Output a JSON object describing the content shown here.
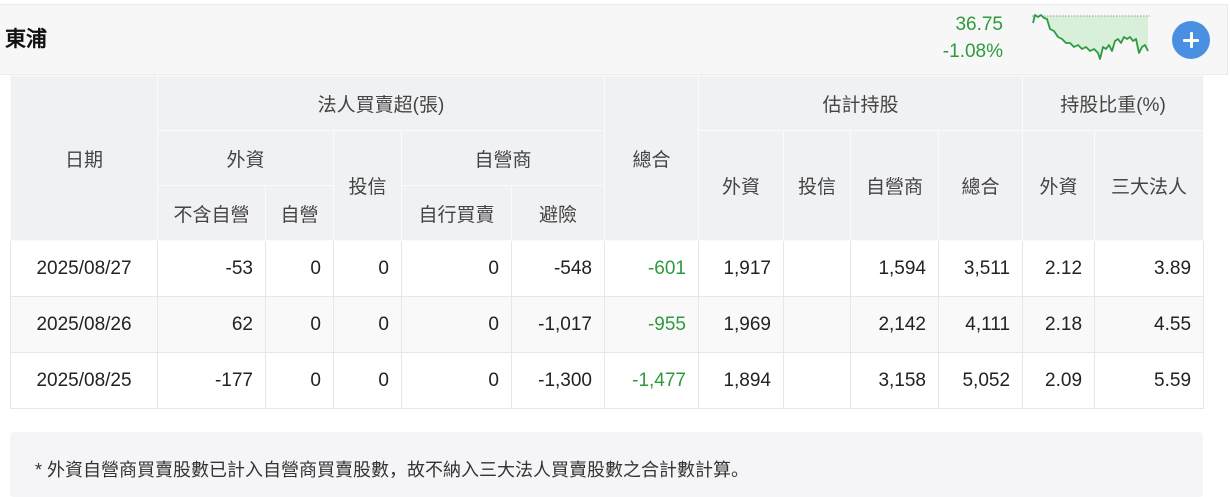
{
  "header": {
    "stock_name": "東浦",
    "price": "36.75",
    "change_pct": "-1.08%"
  },
  "table": {
    "headers": {
      "date": "日期",
      "net_buy_sell": "法人買賣超(張)",
      "foreign": "外資",
      "foreign_ex_dealer": "不含自營",
      "foreign_dealer": "自營",
      "investment_trust": "投信",
      "dealer": "自營商",
      "dealer_self": "自行買賣",
      "dealer_hedge": "避險",
      "total": "總合",
      "est_holdings": "估計持股",
      "est_foreign": "外資",
      "est_trust": "投信",
      "est_dealer": "自營商",
      "est_total": "總合",
      "holding_ratio": "持股比重(%)",
      "ratio_foreign": "外資",
      "ratio_three": "三大法人"
    },
    "rows": [
      {
        "date": "2025/08/27",
        "foreign_ex": "-53",
        "foreign_dealer": "0",
        "trust": "0",
        "dealer_self": "0",
        "dealer_hedge": "-548",
        "total": "-601",
        "est_foreign": "1,917",
        "est_dealer": "1,594",
        "est_total": "3,511",
        "ratio_foreign": "2.12",
        "ratio_three": "3.89"
      },
      {
        "date": "2025/08/26",
        "foreign_ex": "62",
        "foreign_dealer": "0",
        "trust": "0",
        "dealer_self": "0",
        "dealer_hedge": "-1,017",
        "total": "-955",
        "est_foreign": "1,969",
        "est_dealer": "2,142",
        "est_total": "4,111",
        "ratio_foreign": "2.18",
        "ratio_three": "4.55"
      },
      {
        "date": "2025/08/25",
        "foreign_ex": "-177",
        "foreign_dealer": "0",
        "trust": "0",
        "dealer_self": "0",
        "dealer_hedge": "-1,300",
        "total": "-1,477",
        "est_foreign": "1,894",
        "est_dealer": "3,158",
        "est_total": "5,052",
        "ratio_foreign": "2.09",
        "ratio_three": "5.59"
      }
    ]
  },
  "footnote": "* 外資自營商買賣股數已計入自營商買賣股數，故不納入三大法人買賣股數之合計數計算。",
  "icons": {
    "add": "plus-icon",
    "trend": "sparkline"
  },
  "colors": {
    "down": "#2e9a3f",
    "accent": "#4a90e2"
  }
}
